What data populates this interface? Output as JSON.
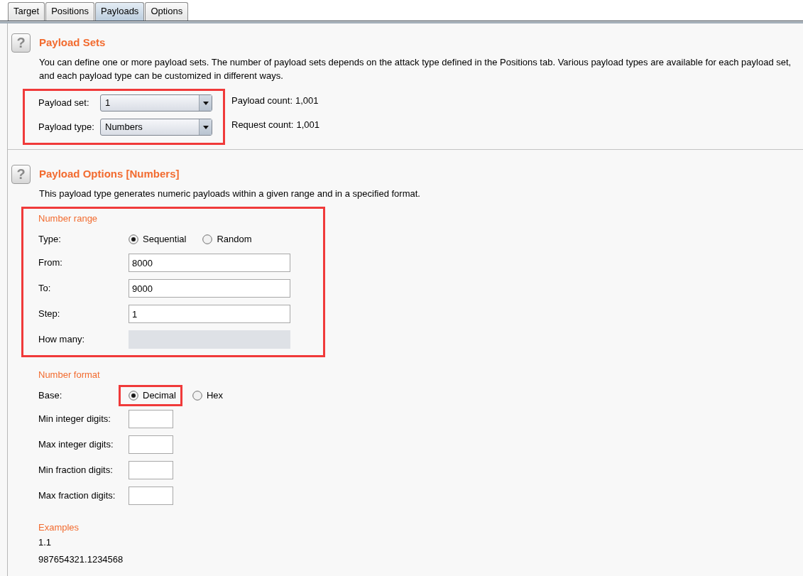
{
  "tabs": [
    {
      "label": "Target",
      "selected": false
    },
    {
      "label": "Positions",
      "selected": false
    },
    {
      "label": "Payloads",
      "selected": true
    },
    {
      "label": "Options",
      "selected": false
    }
  ],
  "payload_sets": {
    "help": "?",
    "title": "Payload Sets",
    "description": "You can define one or more payload sets. The number of payload sets depends on the attack type defined in the Positions tab. Various payload types are available for each payload set, and each payload type can be customized in different ways.",
    "highlighted": true,
    "selectors": [
      {
        "label": "Payload set:",
        "value": "1"
      },
      {
        "label": "Payload type:",
        "value": "Numbers"
      }
    ],
    "counts": [
      {
        "label": "Payload count:",
        "value": "1,001"
      },
      {
        "label": "Request count:",
        "value": "1,001"
      }
    ]
  },
  "payload_options": {
    "help": "?",
    "title": "Payload Options [Numbers]",
    "description": "This payload type generates numeric payloads within a given range and in a specified format.",
    "number_range": {
      "heading": "Number range",
      "highlighted": true,
      "type": {
        "label": "Type:",
        "options": [
          {
            "label": "Sequential",
            "selected": true,
            "highlighted": false
          },
          {
            "label": "Random",
            "selected": false,
            "highlighted": false
          }
        ]
      },
      "fields": [
        {
          "label": "From:",
          "value": "8000",
          "disabled": false
        },
        {
          "label": "To:",
          "value": "9000",
          "disabled": false
        },
        {
          "label": "Step:",
          "value": "1",
          "disabled": false
        },
        {
          "label": "How many:",
          "disabled": true
        }
      ]
    },
    "number_format": {
      "heading": "Number format",
      "base": {
        "label": "Base:",
        "options": [
          {
            "label": "Decimal",
            "selected": true,
            "highlighted": true
          },
          {
            "label": "Hex",
            "selected": false,
            "highlighted": false
          }
        ]
      },
      "fields": [
        {
          "label": "Min integer digits:"
        },
        {
          "label": "Max integer digits:"
        },
        {
          "label": "Min fraction digits:"
        },
        {
          "label": "Max fraction digits:"
        }
      ]
    },
    "examples": {
      "heading": "Examples",
      "lines": [
        "1.1",
        "987654321.1234568"
      ]
    }
  }
}
